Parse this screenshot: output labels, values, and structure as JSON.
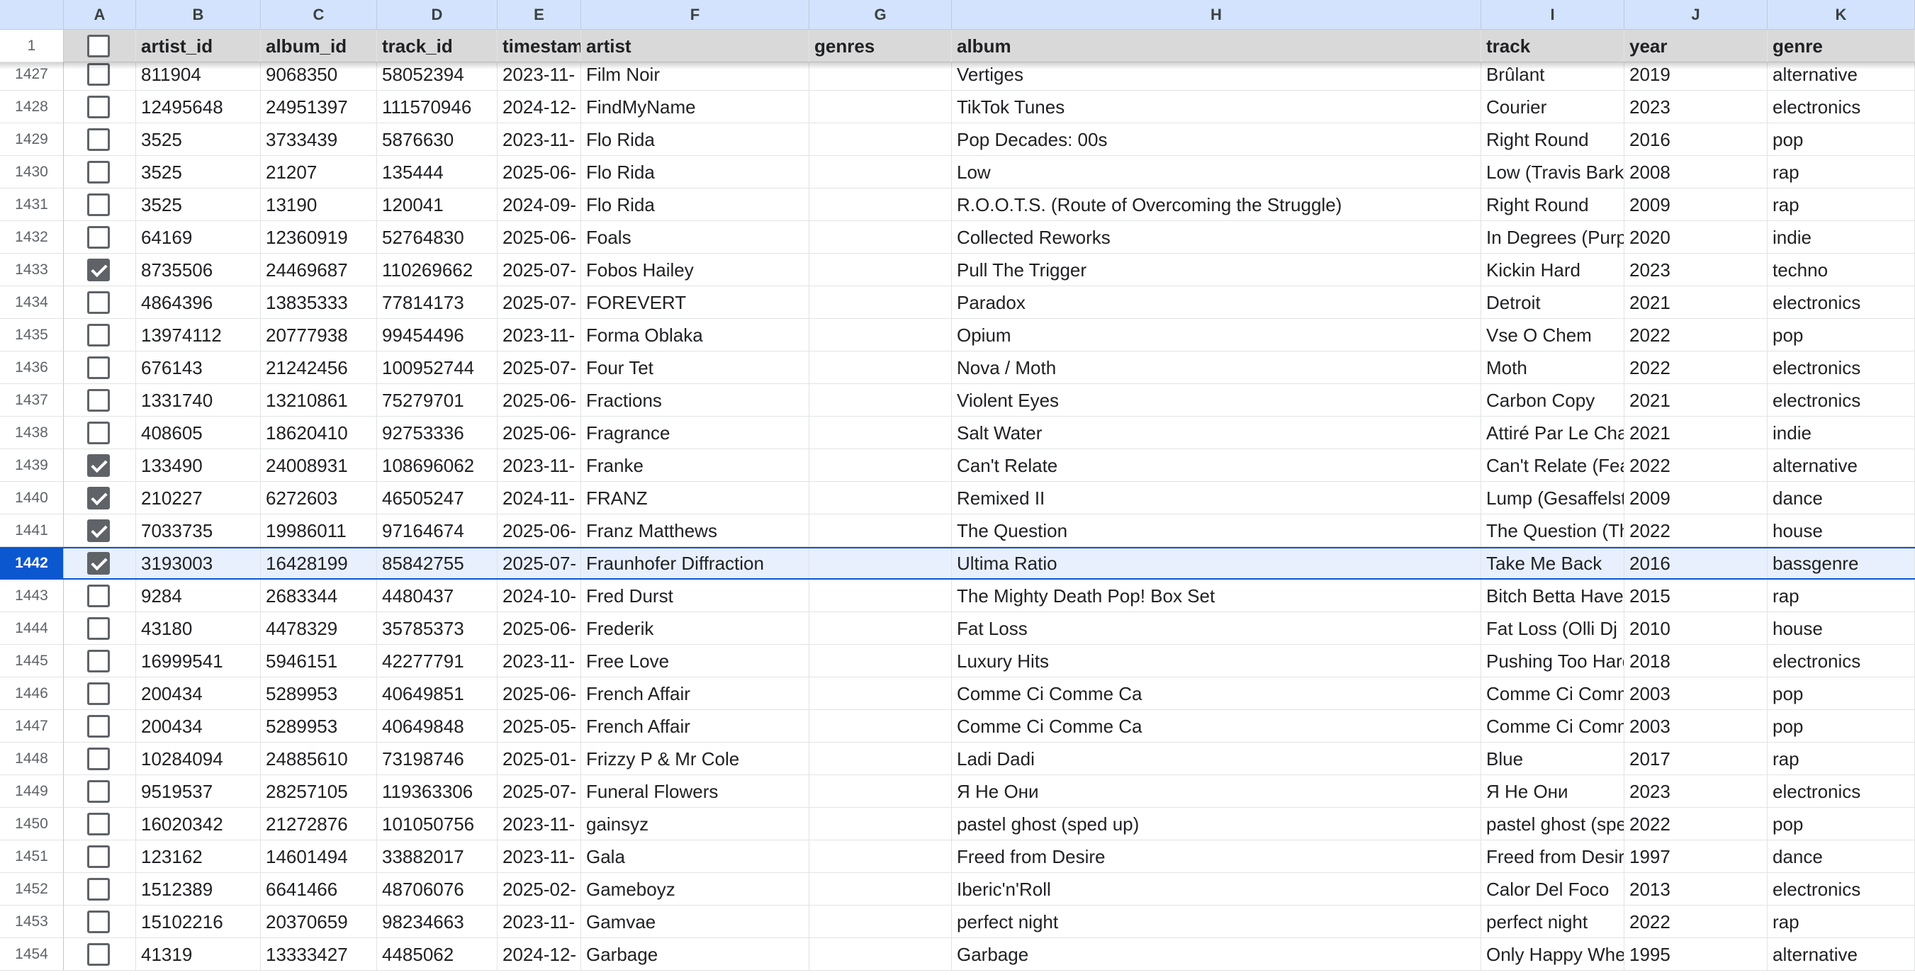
{
  "columns": [
    "A",
    "B",
    "C",
    "D",
    "E",
    "F",
    "G",
    "H",
    "I",
    "J",
    "K"
  ],
  "header_row_number": "1",
  "headers": [
    "",
    "artist_id",
    "album_id",
    "track_id",
    "timestamp",
    "artist",
    "genres",
    "album",
    "track",
    "year",
    "genre"
  ],
  "partial_row": {
    "num": "1427",
    "cells": [
      "",
      "811904",
      "9068350",
      "58052394",
      "2023-11-",
      "Film Noir",
      "",
      "Vertiges",
      "Brûlant",
      "2019",
      "alternative"
    ]
  },
  "selected_row": "1442",
  "rows": [
    {
      "num": "1428",
      "checked": false,
      "cells": [
        "",
        "12495648",
        "24951397",
        "111570946",
        "2024-12-",
        "FindMyName",
        "",
        "TikTok Tunes",
        "Courier",
        "2023",
        "electronics"
      ]
    },
    {
      "num": "1429",
      "checked": false,
      "cells": [
        "",
        "3525",
        "3733439",
        "5876630",
        "2023-11-",
        "Flo Rida",
        "",
        "Pop Decades: 00s",
        "Right Round",
        "2016",
        "pop"
      ]
    },
    {
      "num": "1430",
      "checked": false,
      "cells": [
        "",
        "3525",
        "21207",
        "135444",
        "2025-06-",
        "Flo Rida",
        "",
        "Low",
        "Low (Travis Barker",
        "2008",
        "rap"
      ]
    },
    {
      "num": "1431",
      "checked": false,
      "cells": [
        "",
        "3525",
        "13190",
        "120041",
        "2024-09-",
        "Flo Rida",
        "",
        "R.O.O.T.S. (Route of Overcoming the Struggle)",
        "Right Round",
        "2009",
        "rap"
      ]
    },
    {
      "num": "1432",
      "checked": false,
      "cells": [
        "",
        "64169",
        "12360919",
        "52764830",
        "2025-06-",
        "Foals",
        "",
        "Collected Reworks",
        "In Degrees (Purple",
        "2020",
        "indie"
      ]
    },
    {
      "num": "1433",
      "checked": true,
      "cells": [
        "",
        "8735506",
        "24469687",
        "110269662",
        "2025-07-",
        "Fobos Hailey",
        "",
        "Pull The Trigger",
        "Kickin Hard",
        "2023",
        "techno"
      ]
    },
    {
      "num": "1434",
      "checked": false,
      "cells": [
        "",
        "4864396",
        "13835333",
        "77814173",
        "2025-07-",
        "FOREVERT",
        "",
        "Paradox",
        "Detroit",
        "2021",
        "electronics"
      ]
    },
    {
      "num": "1435",
      "checked": false,
      "cells": [
        "",
        "13974112",
        "20777938",
        "99454496",
        "2023-11-",
        "Forma Oblaka",
        "",
        "Opium",
        "Vse O Chem",
        "2022",
        "pop"
      ]
    },
    {
      "num": "1436",
      "checked": false,
      "cells": [
        "",
        "676143",
        "21242456",
        "100952744",
        "2025-07-",
        "Four Tet",
        "",
        "Nova / Moth",
        "Moth",
        "2022",
        "electronics"
      ]
    },
    {
      "num": "1437",
      "checked": false,
      "cells": [
        "",
        "1331740",
        "13210861",
        "75279701",
        "2025-06-",
        "Fractions",
        "",
        "Violent Eyes",
        "Carbon Copy",
        "2021",
        "electronics"
      ]
    },
    {
      "num": "1438",
      "checked": false,
      "cells": [
        "",
        "408605",
        "18620410",
        "92753336",
        "2025-06-",
        "Fragrance",
        "",
        "Salt Water",
        "Attiré Par Le Chaos",
        "2021",
        "indie"
      ]
    },
    {
      "num": "1439",
      "checked": true,
      "cells": [
        "",
        "133490",
        "24008931",
        "108696062",
        "2023-11-",
        "Franke",
        "",
        "Can't Relate",
        "Can't Relate (Feat.",
        "2022",
        "alternative"
      ]
    },
    {
      "num": "1440",
      "checked": true,
      "cells": [
        "",
        "210227",
        "6272603",
        "46505247",
        "2024-11-",
        "FRANZ",
        "",
        "Remixed II",
        "Lump (Gesaffelstein",
        "2009",
        "dance"
      ]
    },
    {
      "num": "1441",
      "checked": true,
      "cells": [
        "",
        "7033735",
        "19986011",
        "97164674",
        "2025-06-",
        "Franz Matthews",
        "",
        "The Question",
        "The Question (The",
        "2022",
        "house"
      ]
    },
    {
      "num": "1442",
      "checked": true,
      "cells": [
        "",
        "3193003",
        "16428199",
        "85842755",
        "2025-07-",
        "Fraunhofer Diffraction",
        "",
        "Ultima Ratio",
        "Take Me Back",
        "2016",
        "bassgenre"
      ]
    },
    {
      "num": "1443",
      "checked": false,
      "cells": [
        "",
        "9284",
        "2683344",
        "4480437",
        "2024-10-",
        "Fred Durst",
        "",
        "The Mighty Death Pop! Box Set",
        "Bitch Betta Have M",
        "2015",
        "rap"
      ]
    },
    {
      "num": "1444",
      "checked": false,
      "cells": [
        "",
        "43180",
        "4478329",
        "35785373",
        "2025-06-",
        "Frederik",
        "",
        "Fat Loss",
        "Fat Loss (Olli Dj Re",
        "2010",
        "house"
      ]
    },
    {
      "num": "1445",
      "checked": false,
      "cells": [
        "",
        "16999541",
        "5946151",
        "42277791",
        "2023-11-",
        "Free Love",
        "",
        "Luxury Hits",
        "Pushing Too Hard",
        "2018",
        "electronics"
      ]
    },
    {
      "num": "1446",
      "checked": false,
      "cells": [
        "",
        "200434",
        "5289953",
        "40649851",
        "2025-06-",
        "French Affair",
        "",
        "Comme Ci Comme Ca",
        "Comme Ci Comme",
        "2003",
        "pop"
      ]
    },
    {
      "num": "1447",
      "checked": false,
      "cells": [
        "",
        "200434",
        "5289953",
        "40649848",
        "2025-05-",
        "French Affair",
        "",
        "Comme Ci Comme Ca",
        "Comme Ci Comme",
        "2003",
        "pop"
      ]
    },
    {
      "num": "1448",
      "checked": false,
      "cells": [
        "",
        "10284094",
        "24885610",
        "73198746",
        "2025-01-",
        "Frizzy P & Mr Cole",
        "",
        "Ladi Dadi",
        "Blue",
        "2017",
        "rap"
      ]
    },
    {
      "num": "1449",
      "checked": false,
      "cells": [
        "",
        "9519537",
        "28257105",
        "119363306",
        "2025-07-",
        "Funeral Flowers",
        "",
        "Я Не Они",
        "Я Не Они",
        "2023",
        "electronics"
      ]
    },
    {
      "num": "1450",
      "checked": false,
      "cells": [
        "",
        "16020342",
        "21272876",
        "101050756",
        "2023-11-",
        "gainsyz",
        "",
        "pastel ghost (sped up)",
        "pastel ghost (sped",
        "2022",
        "pop"
      ]
    },
    {
      "num": "1451",
      "checked": false,
      "cells": [
        "",
        "123162",
        "14601494",
        "33882017",
        "2023-11-",
        "Gala",
        "",
        "Freed from Desire",
        "Freed from Desire",
        "1997",
        "dance"
      ]
    },
    {
      "num": "1452",
      "checked": false,
      "cells": [
        "",
        "1512389",
        "6641466",
        "48706076",
        "2025-02-",
        "Gameboyz",
        "",
        "Iberic'n'Roll",
        "Calor Del Foco",
        "2013",
        "electronics"
      ]
    },
    {
      "num": "1453",
      "checked": false,
      "cells": [
        "",
        "15102216",
        "20370659",
        "98234663",
        "2023-11-",
        "Gamvae",
        "",
        "perfect night",
        "perfect night",
        "2022",
        "rap"
      ]
    },
    {
      "num": "1454",
      "checked": false,
      "cells": [
        "",
        "41319",
        "13333427",
        "4485062",
        "2024-12-",
        "Garbage",
        "",
        "Garbage",
        "Only Happy When",
        "1995",
        "alternative"
      ]
    }
  ],
  "colors": {
    "column_header_bg": "#d3e3fd",
    "header_row_bg": "#d9d9d9",
    "selection": "#0b57d0",
    "selected_fill": "#e8f0fe",
    "checkbox": "#5f6368"
  }
}
